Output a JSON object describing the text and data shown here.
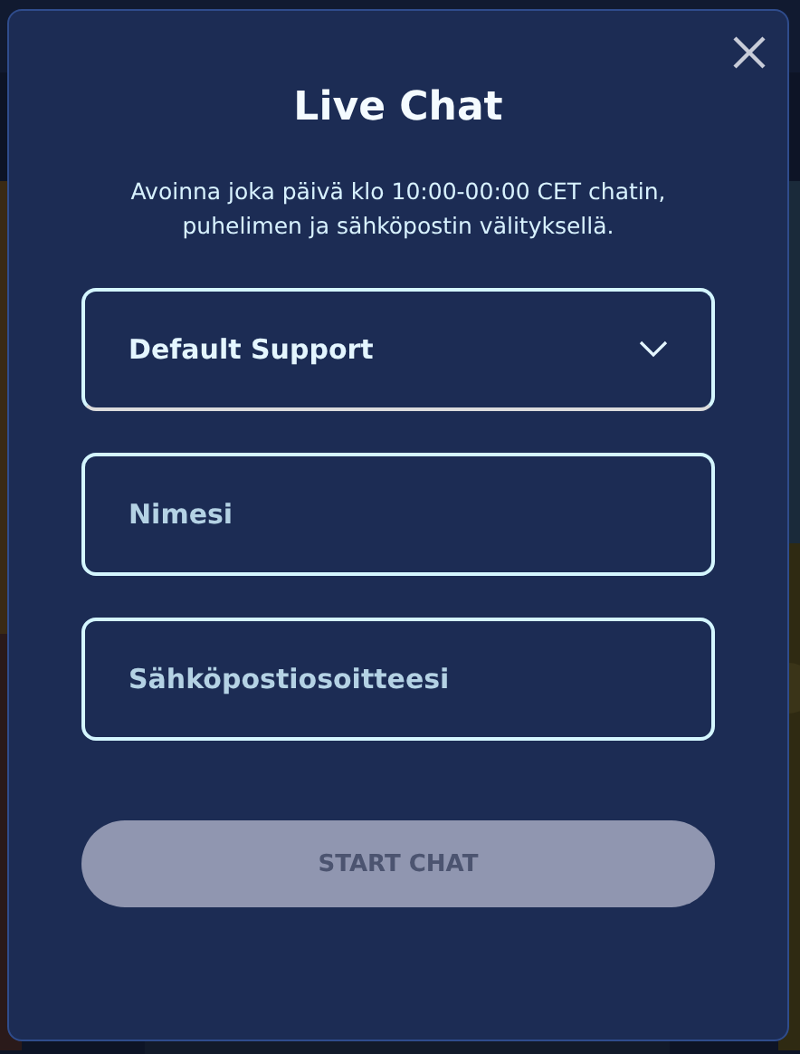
{
  "dialog": {
    "title": "Live Chat",
    "description": "Avoinna joka päivä klo 10:00-00:00 CET chatin, puhelimen ja sähköpostin välityksellä.",
    "department": {
      "value": "Default Support"
    },
    "fields": [
      {
        "placeholder": "Nimesi"
      },
      {
        "placeholder": "Sähköpostiosoitteesi"
      }
    ],
    "submit": {
      "label": "START CHAT",
      "disabled": true
    }
  }
}
